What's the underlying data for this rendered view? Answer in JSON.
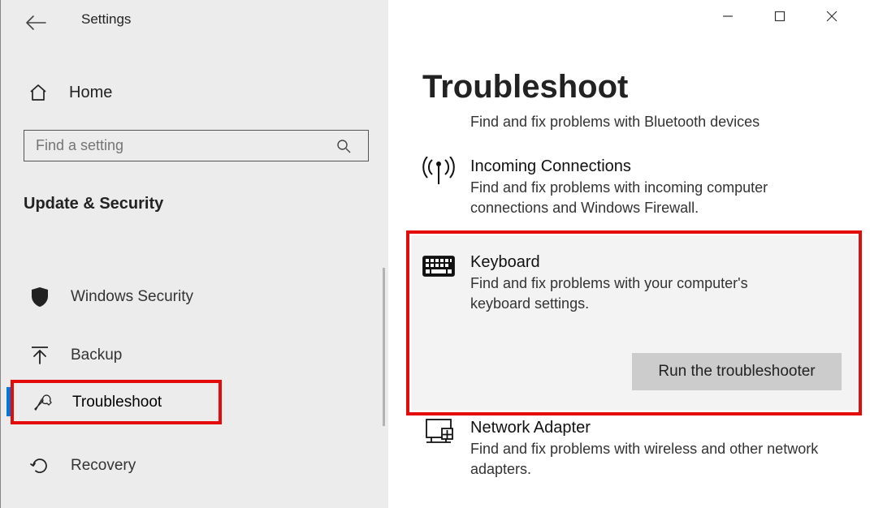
{
  "app": {
    "title": "Settings"
  },
  "search": {
    "placeholder": "Find a setting"
  },
  "home": {
    "label": "Home"
  },
  "category": "Update & Security",
  "nav": {
    "security": "Windows Security",
    "backup": "Backup",
    "troubleshoot": "Troubleshoot",
    "recovery": "Recovery"
  },
  "page": {
    "title": "Troubleshoot"
  },
  "items": {
    "bluetooth": {
      "sub": "Find and fix problems with Bluetooth devices"
    },
    "incoming": {
      "title": "Incoming Connections",
      "sub": "Find and fix problems with incoming computer connections and Windows Firewall."
    },
    "keyboard": {
      "title": "Keyboard",
      "sub": "Find and fix problems with your computer's keyboard settings."
    },
    "network": {
      "title": "Network Adapter",
      "sub": "Find and fix problems with wireless and other network adapters."
    }
  },
  "actions": {
    "run": "Run the troubleshooter"
  }
}
